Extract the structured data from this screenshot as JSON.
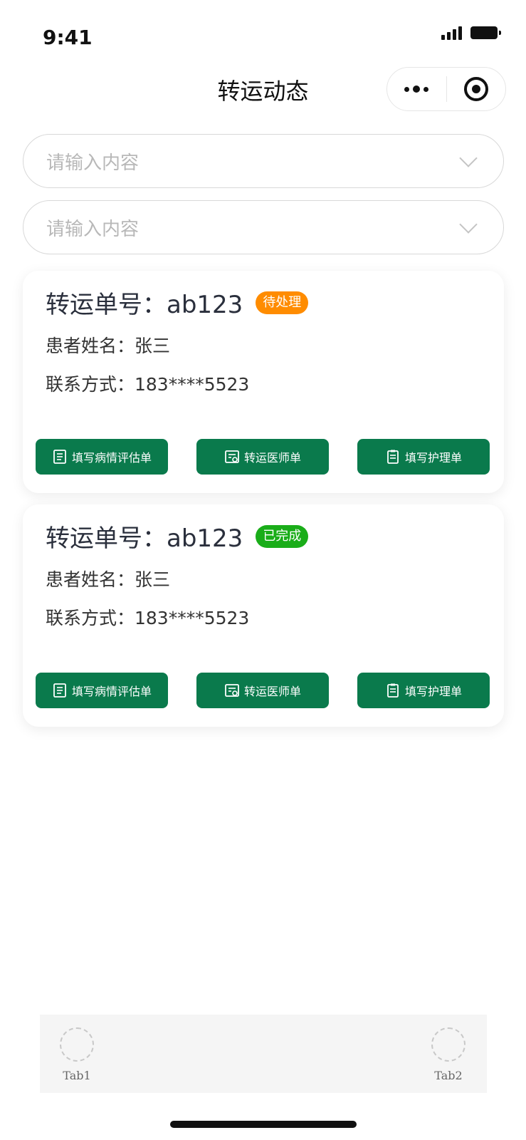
{
  "status_bar": {
    "time": "9:41"
  },
  "nav": {
    "title": "转运动态"
  },
  "filters": [
    {
      "placeholder": "请输入内容"
    },
    {
      "placeholder": "请输入内容"
    }
  ],
  "cards": [
    {
      "order_label": "转运单号：ab123",
      "status": "待处理",
      "status_color": "#ff8c00",
      "patient_line": "患者姓名：张三",
      "contact_line": "联系方式：183****5523",
      "buttons": [
        "填写病情评估单",
        "转运医师单",
        "填写护理单"
      ]
    },
    {
      "order_label": "转运单号：ab123",
      "status": "已完成",
      "status_color": "#1aad19",
      "patient_line": "患者姓名：张三",
      "contact_line": "联系方式：183****5523",
      "buttons": [
        "填写病情评估单",
        "转运医师单",
        "填写护理单"
      ]
    }
  ],
  "tabbar": {
    "tab1": "Tab1",
    "tab2": "Tab2"
  },
  "colors": {
    "primary_button": "#0a7a4c"
  }
}
